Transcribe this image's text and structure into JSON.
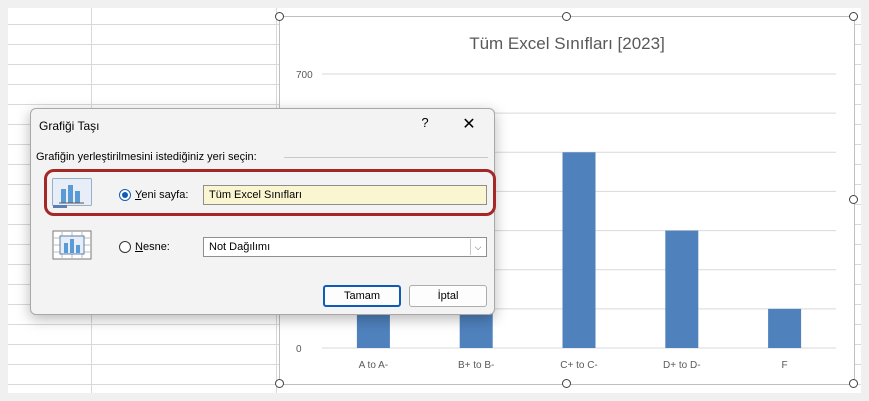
{
  "chart": {
    "title": "Tüm Excel Sınıfları [2023]",
    "y_tick_labels": [
      "700",
      "0"
    ],
    "handles": [
      "top-left",
      "top-center",
      "top-right",
      "middle-right",
      "bottom-left",
      "bottom-center",
      "bottom-right"
    ]
  },
  "chart_data": {
    "type": "bar",
    "title": "Tüm Excel Sınıfları [2023]",
    "categories": [
      "A to A-",
      "B+ to B-",
      "C+ to C-",
      "D+ to D-",
      "F"
    ],
    "values": [
      400,
      460,
      500,
      300,
      100
    ],
    "ylim": [
      0,
      700
    ],
    "y_ticks": [
      0,
      100,
      200,
      300,
      400,
      500,
      600,
      700
    ],
    "grid": true,
    "bar_color": "#4f81bd"
  },
  "dialog": {
    "title": "Grafiği Taşı",
    "help": "?",
    "close": "✕",
    "prompt": "Grafiğin yerleştirilmesini istediğiniz yeri seçin:",
    "option_new_sheet": {
      "accel": "Y",
      "rest": "eni sayfa:",
      "value": "Tüm Excel Sınıfları",
      "selected": true
    },
    "option_object": {
      "accel": "N",
      "rest": "esne:",
      "value": "Not Dağılımı",
      "selected": false
    },
    "ok_label": "Tamam",
    "cancel_label": "İptal",
    "highlight_color": "#a52828",
    "accent_color": "#0f5cb8"
  }
}
